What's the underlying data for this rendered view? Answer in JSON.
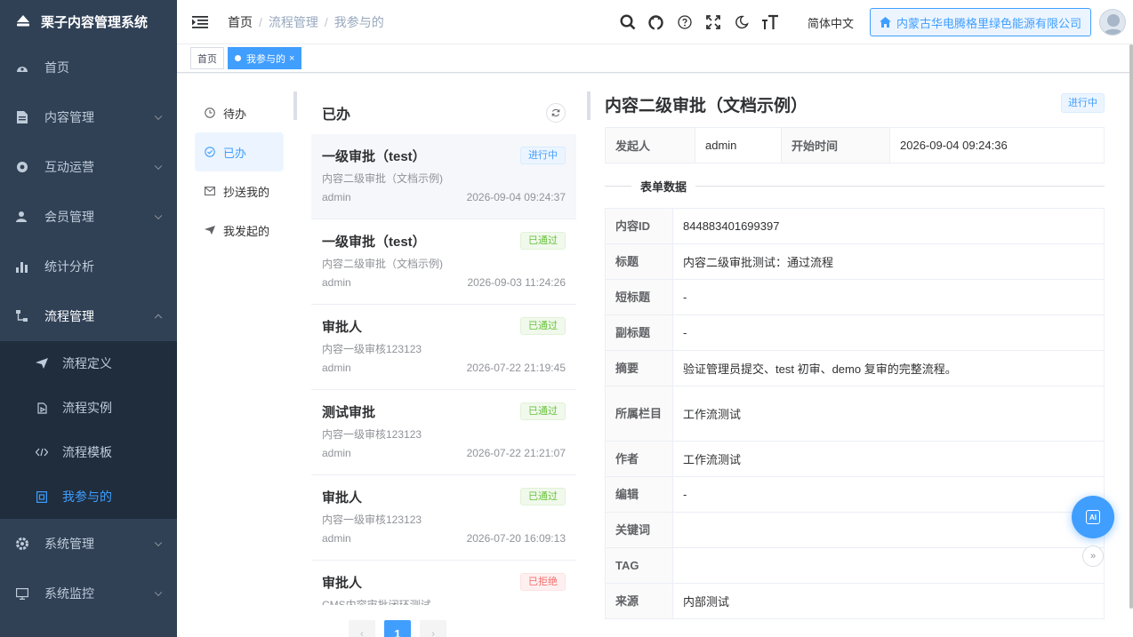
{
  "app": {
    "title": "栗子内容管理系统"
  },
  "sidebar": {
    "items": [
      {
        "label": "首页",
        "icon": "dashboard-icon"
      },
      {
        "label": "内容管理",
        "icon": "document-icon"
      },
      {
        "label": "互动运营",
        "icon": "interaction-icon"
      },
      {
        "label": "会员管理",
        "icon": "members-icon"
      },
      {
        "label": "统计分析",
        "icon": "chart-icon"
      },
      {
        "label": "流程管理",
        "icon": "workflow-icon"
      },
      {
        "label": "系统管理",
        "icon": "gear-icon"
      },
      {
        "label": "系统监控",
        "icon": "monitor-icon"
      }
    ],
    "workflow_sub": [
      {
        "label": "流程定义",
        "icon": "send-icon"
      },
      {
        "label": "流程实例",
        "icon": "instance-icon"
      },
      {
        "label": "流程模板",
        "icon": "code-icon"
      },
      {
        "label": "我参与的",
        "icon": "participate-icon"
      }
    ]
  },
  "header": {
    "breadcrumb": [
      "首页",
      "流程管理",
      "我参与的"
    ],
    "lang": "简体中文",
    "tenant": "内蒙古华电腾格里绿色能源有限公司"
  },
  "tags": [
    {
      "label": "首页"
    },
    {
      "label": "我参与的",
      "close": "×"
    }
  ],
  "categories": [
    {
      "label": "待办",
      "icon": "clock-icon"
    },
    {
      "label": "已办",
      "icon": "check-circle-icon"
    },
    {
      "label": "抄送我的",
      "icon": "mail-icon"
    },
    {
      "label": "我发起的",
      "icon": "send-icon"
    }
  ],
  "list": {
    "title": "已办",
    "items": [
      {
        "title": "一级审批（test）",
        "status": "进行中",
        "sub": "内容二级审批（文档示例)",
        "user": "admin",
        "time": "2026-09-04 09:24:37"
      },
      {
        "title": "一级审批（test）",
        "status": "已通过",
        "sub": "内容二级审批（文档示例)",
        "user": "admin",
        "time": "2026-09-03 11:24:26"
      },
      {
        "title": "审批人",
        "status": "已通过",
        "sub": "内容一级审核123123",
        "user": "admin",
        "time": "2026-07-22 21:19:45"
      },
      {
        "title": "测试审批",
        "status": "已通过",
        "sub": "内容一级审核123123",
        "user": "admin",
        "time": "2026-07-22 21:21:07"
      },
      {
        "title": "审批人",
        "status": "已通过",
        "sub": "内容一级审核123123",
        "user": "admin",
        "time": "2026-07-20 16:09:13"
      },
      {
        "title": "审批人",
        "status": "已拒绝",
        "sub": "CMS内容审批闭环测试",
        "user": "",
        "time": ""
      }
    ],
    "pager": {
      "prev": "‹",
      "current": "1",
      "next": "›"
    }
  },
  "detail": {
    "title": "内容二级审批（文档示例）",
    "status": "进行中",
    "initiator_label": "发起人",
    "initiator": "admin",
    "start_label": "开始时间",
    "start_time": "2026-09-04 09:24:36",
    "section": "表单数据",
    "fields": [
      {
        "label": "内容ID",
        "value": "844883401699397"
      },
      {
        "label": "标题",
        "value": "内容二级审批测试：通过流程"
      },
      {
        "label": "短标题",
        "value": "-"
      },
      {
        "label": "副标题",
        "value": "-"
      },
      {
        "label": "摘要",
        "value": "验证管理员提交、test 初审、demo 复审的完整流程。"
      },
      {
        "label": "所属栏目",
        "value": "工作流测试"
      },
      {
        "label": "作者",
        "value": "工作流测试"
      },
      {
        "label": "编辑",
        "value": "-"
      },
      {
        "label": "关键词",
        "value": ""
      },
      {
        "label": "TAG",
        "value": ""
      },
      {
        "label": "来源",
        "value": "内部测试"
      }
    ]
  },
  "ai": {
    "label": "AI"
  },
  "collapse": {
    "label": "»"
  },
  "colors": {
    "sidebar_bg": "#304156",
    "submenu_bg": "#1f2d3d",
    "accent": "#409eff",
    "success": "#67c23a",
    "danger": "#f56c6c"
  }
}
